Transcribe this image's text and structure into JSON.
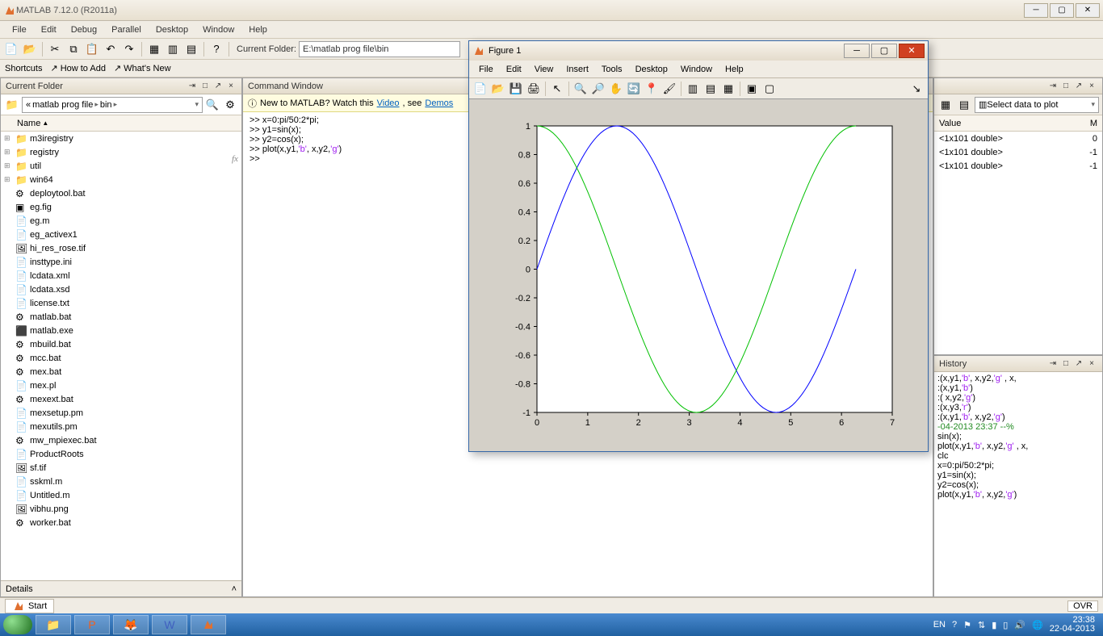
{
  "app_title": "MATLAB  7.12.0 (R2011a)",
  "menubar": [
    "File",
    "Edit",
    "Debug",
    "Parallel",
    "Desktop",
    "Window",
    "Help"
  ],
  "toolbar": {
    "current_folder_label": "Current Folder:",
    "path": "E:\\matlab prog file\\bin"
  },
  "shortcuts": {
    "label": "Shortcuts",
    "how": "How to Add",
    "whats": "What's New"
  },
  "current_folder_panel": {
    "title": "Current Folder",
    "crumbs": [
      "matlab prog file",
      "bin"
    ],
    "name_col": "Name",
    "items": [
      {
        "name": "m3iregistry",
        "type": "folder",
        "expand": true
      },
      {
        "name": "registry",
        "type": "folder",
        "expand": true
      },
      {
        "name": "util",
        "type": "folder",
        "expand": true
      },
      {
        "name": "win64",
        "type": "folder",
        "expand": true
      },
      {
        "name": "deploytool.bat",
        "type": "bat"
      },
      {
        "name": "eg.fig",
        "type": "fig"
      },
      {
        "name": "eg.m",
        "type": "m"
      },
      {
        "name": "eg_activex1",
        "type": "file"
      },
      {
        "name": "hi_res_rose.tif",
        "type": "img"
      },
      {
        "name": "insttype.ini",
        "type": "ini"
      },
      {
        "name": "lcdata.xml",
        "type": "xml"
      },
      {
        "name": "lcdata.xsd",
        "type": "xsd"
      },
      {
        "name": "license.txt",
        "type": "txt"
      },
      {
        "name": "matlab.bat",
        "type": "bat"
      },
      {
        "name": "matlab.exe",
        "type": "exe"
      },
      {
        "name": "mbuild.bat",
        "type": "bat"
      },
      {
        "name": "mcc.bat",
        "type": "bat"
      },
      {
        "name": "mex.bat",
        "type": "bat"
      },
      {
        "name": "mex.pl",
        "type": "file"
      },
      {
        "name": "mexext.bat",
        "type": "bat"
      },
      {
        "name": "mexsetup.pm",
        "type": "file"
      },
      {
        "name": "mexutils.pm",
        "type": "file"
      },
      {
        "name": "mw_mpiexec.bat",
        "type": "bat"
      },
      {
        "name": "ProductRoots",
        "type": "file"
      },
      {
        "name": "sf.tif",
        "type": "img"
      },
      {
        "name": "sskml.m",
        "type": "m"
      },
      {
        "name": "Untitled.m",
        "type": "m"
      },
      {
        "name": "vibhu.png",
        "type": "img"
      },
      {
        "name": "worker.bat",
        "type": "bat"
      }
    ],
    "details": "Details"
  },
  "command_window": {
    "title": "Command Window",
    "banner_prefix": "New to MATLAB? Watch this ",
    "banner_link1": "Video",
    "banner_mid": ", see ",
    "banner_link2": "Demos",
    "lines": [
      ">> x=0:pi/50:2*pi;",
      ">> y1=sin(x);",
      ">> y2=cos(x);",
      ">> plot(x,y1,'b', x,y2,'g')",
      ">> "
    ]
  },
  "workspace": {
    "select_label": "Select data to plot",
    "col_value": "Value",
    "col_min": "M",
    "rows": [
      {
        "value": "<1x101 double>",
        "min": "0"
      },
      {
        "value": "<1x101 double>",
        "min": "-1"
      },
      {
        "value": "<1x101 double>",
        "min": "-1"
      }
    ]
  },
  "history": {
    "title": "History",
    "lines": [
      {
        "t": ":(x,y1,'b', x,y2,'g' , x,"
      },
      {
        "t": ":(x,y1,'b')"
      },
      {
        "t": ":( x,y2,'g')"
      },
      {
        "t": ":(x,y3,'r')"
      },
      {
        "t": ":(x,y1,'b', x,y2,'g')"
      },
      {
        "t": "-04-2013 23:37 --%",
        "cmt": true
      },
      {
        "t": "sin(x);"
      },
      {
        "t": "plot(x,y1,'b', x,y2,'g' , x,"
      },
      {
        "t": "clc"
      },
      {
        "t": "x=0:pi/50:2*pi;"
      },
      {
        "t": "y1=sin(x);"
      },
      {
        "t": "y2=cos(x);"
      },
      {
        "t": "plot(x,y1,'b', x,y2,'g')"
      }
    ]
  },
  "figure": {
    "title": "Figure 1",
    "menubar": [
      "File",
      "Edit",
      "View",
      "Insert",
      "Tools",
      "Desktop",
      "Window",
      "Help"
    ]
  },
  "chart_data": {
    "type": "line",
    "title": "",
    "xlabel": "",
    "ylabel": "",
    "xlim": [
      0,
      7
    ],
    "ylim": [
      -1,
      1
    ],
    "xticks": [
      0,
      1,
      2,
      3,
      4,
      5,
      6,
      7
    ],
    "yticks": [
      -1,
      -0.8,
      -0.6,
      -0.4,
      -0.2,
      0,
      0.2,
      0.4,
      0.6,
      0.8,
      1
    ],
    "x_step": "pi/50",
    "x_range": "0 to 2*pi",
    "series": [
      {
        "name": "y1 = sin(x)",
        "color": "#0000ff",
        "function": "sin"
      },
      {
        "name": "y2 = cos(x)",
        "color": "#00c000",
        "function": "cos"
      }
    ]
  },
  "statusbar": {
    "start": "Start",
    "ovr": "OVR"
  },
  "tray": {
    "lang": "EN",
    "time": "23:38",
    "date": "22-04-2013"
  }
}
